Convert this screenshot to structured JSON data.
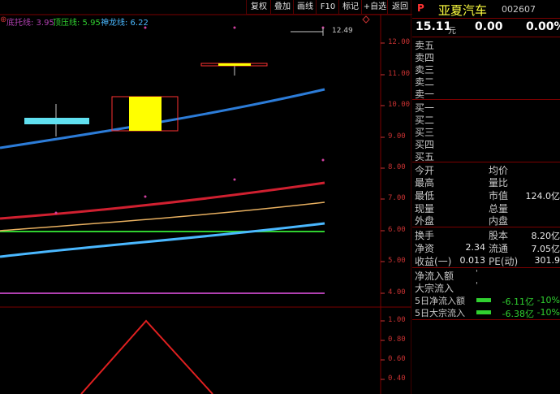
{
  "toolbar": {
    "buttons": [
      "复权",
      "叠加",
      "画线",
      "F10",
      "标记",
      "+自选",
      "返回"
    ]
  },
  "legend": {
    "marker": "⊕",
    "bottom": "底托线: 3.95",
    "top": "顶压线: 5.95",
    "dragon": "神龙线: 6.22"
  },
  "colors": {
    "bottom_line": "#b040b0",
    "top_line": "#30d030",
    "dragon_line": "#4ab8ff",
    "frame": "#7a0000",
    "up": "#ff3232",
    "down": "#30d030",
    "yellow": "#ffff00"
  },
  "main_axis": [
    "12.00",
    "11.00",
    "10.00",
    "9.00",
    "8.00",
    "7.00",
    "6.00",
    "5.00",
    "4.00"
  ],
  "sub_axis": [
    "1.00",
    "0.80",
    "0.60",
    "0.40"
  ],
  "price_note": "12.49",
  "stock": {
    "p_flag": "P",
    "name": "亚夏汽车",
    "code": "002607",
    "price": "15.11",
    "unit": "元",
    "change": "0.00",
    "change_pct": "0.00%"
  },
  "sell_levels": [
    "卖五",
    "卖四",
    "卖三",
    "卖二",
    "卖一"
  ],
  "buy_levels": [
    "买一",
    "买二",
    "买三",
    "买四",
    "买五"
  ],
  "stats": {
    "open": "今开",
    "avg": "均价",
    "high": "最高",
    "vol_ratio": "量比",
    "low": "最低",
    "mktcap": "市值",
    "mktcap_val": "124.0亿",
    "cur_vol": "现量",
    "total_vol": "总量",
    "outer": "外盘",
    "inner": "内盘"
  },
  "fundamentals": {
    "turnover": "换手",
    "capital": "股本",
    "capital_val": "8.20亿",
    "nav": "净资",
    "nav_val": "2.34",
    "float": "流通",
    "float_val": "7.05亿",
    "eps": "收益(一)",
    "eps_val": "0.013",
    "pe": "PE(动)",
    "pe_val": "301.9"
  },
  "flows": {
    "net_in": "净流入额",
    "net_in_val": "'",
    "block_in": "大宗流入",
    "block_in_val": "'",
    "net5": "5日净流入额",
    "net5_val": "-6.11亿",
    "net5_pct": "-10%",
    "block5": "5日大宗流入",
    "block5_val": "-6.38亿",
    "block5_pct": "-10%"
  }
}
